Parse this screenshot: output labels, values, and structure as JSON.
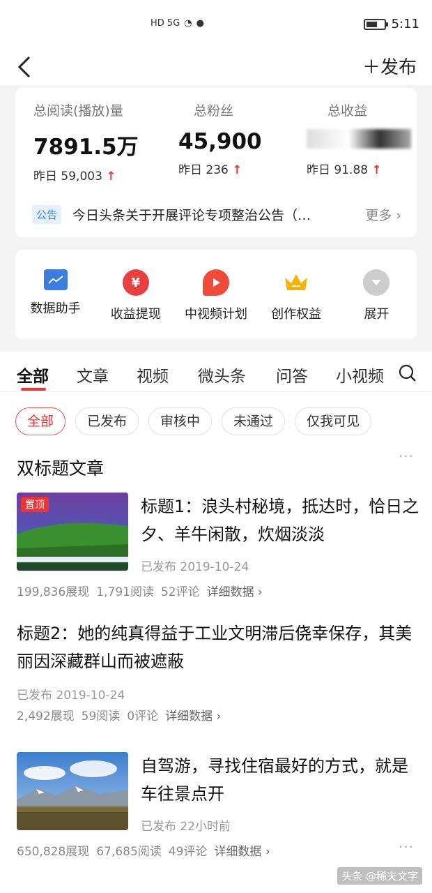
{
  "status_bar": {
    "network": "HD 5G",
    "time": "5:11"
  },
  "header": {
    "publish_label": "＋发布"
  },
  "stats": {
    "reads": {
      "label": "总阅读(播放)量",
      "value": "7891.5万",
      "sub": "昨日 59,003"
    },
    "fans": {
      "label": "总粉丝",
      "value": "45,900",
      "sub": "昨日 236"
    },
    "income": {
      "label": "总收益",
      "sub": "昨日 91.88"
    },
    "arrow": "↑"
  },
  "notice": {
    "tag": "公告",
    "text": "今日头条关于开展评论专项整治公告（…",
    "more": "更多 ›"
  },
  "tools": [
    {
      "label": "数据助手",
      "icon": "chart-icon",
      "color": "#3b7de0"
    },
    {
      "label": "收益提现",
      "icon": "yuan-icon",
      "color": "#e84040"
    },
    {
      "label": "中视频计划",
      "icon": "play-icon",
      "color": "#ef4b3b"
    },
    {
      "label": "创作权益",
      "icon": "crown-icon",
      "color": "#f5b400"
    },
    {
      "label": "展开",
      "icon": "expand-icon",
      "color": "#cccccc"
    }
  ],
  "tabs": [
    "全部",
    "文章",
    "视频",
    "微头条",
    "问答",
    "小视频"
  ],
  "filters": [
    "全部",
    "已发布",
    "审核中",
    "未通过",
    "仅我可见"
  ],
  "section_title": "双标题文章",
  "articles": [
    {
      "pin": "置顶",
      "title": "标题1：浪头村秘境，抵达时，恰日之夕、羊牛闲散，炊烟淡淡",
      "meta": "已发布  2019-10-24",
      "views": "199,836展现",
      "reads": "1,791阅读",
      "comments": "52评论",
      "detail": "详细数据 ›"
    },
    {
      "title": "标题2：她的纯真得益于工业文明滞后侥幸保存，其美丽因深藏群山而被遮蔽",
      "meta": "已发布  2019-10-24",
      "views": "2,492展现",
      "reads": "59阅读",
      "comments": "0评论",
      "detail": "详细数据 ›"
    },
    {
      "title": "自驾游，寻找住宿最好的方式，就是车往景点开",
      "meta": "已发布  22小时前",
      "views": "650,828展现",
      "reads": "67,685阅读",
      "comments": "49评论",
      "detail": "详细数据 ›"
    }
  ],
  "watermark": "头条 @稀夫文字"
}
